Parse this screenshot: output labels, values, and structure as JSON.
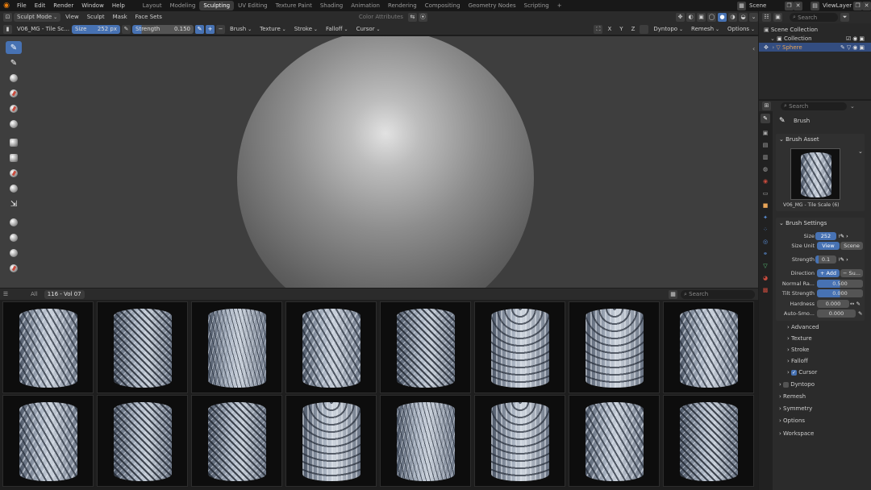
{
  "menu": [
    "File",
    "Edit",
    "Render",
    "Window",
    "Help"
  ],
  "workspaces": [
    "Layout",
    "Modeling",
    "Sculpting",
    "UV Editing",
    "Texture Paint",
    "Shading",
    "Animation",
    "Rendering",
    "Compositing",
    "Geometry Nodes",
    "Scripting"
  ],
  "active_workspace": "Sculpting",
  "scene": "Scene",
  "view_layer": "ViewLayer",
  "header1": {
    "mode": "Sculpt Mode",
    "menus": [
      "View",
      "Sculpt",
      "Mask",
      "Face Sets"
    ],
    "color_attributes": "Color Attributes"
  },
  "header2": {
    "brush_name": "V06_MG - Tile Sc...",
    "size_label": "Size",
    "size_value": "252 px",
    "strength_label": "Strength",
    "strength_value": "0.150",
    "menus": [
      "Brush",
      "Texture",
      "Stroke",
      "Falloff",
      "Cursor"
    ],
    "axes": [
      "X",
      "Y",
      "Z"
    ],
    "dyntopo": "Dyntopo",
    "remesh": "Remesh",
    "options": "Options"
  },
  "outliner": {
    "search_placeholder": "Search",
    "scene_collection": "Scene Collection",
    "collection": "Collection",
    "object": "Sphere"
  },
  "asset_browser": {
    "catalog_all": "All",
    "catalog_current": "116 - Vol 07",
    "search_placeholder": "Search",
    "thumbnails": 16
  },
  "properties": {
    "search_placeholder": "Search",
    "brush_title": "Brush",
    "brush_asset_panel": "Brush Asset",
    "asset_name": "V06_MG - Tile Scale (6)",
    "brush_settings_panel": "Brush Settings",
    "size_label": "Size",
    "size_value": "252",
    "size_unit_label": "Size Unit",
    "size_unit_view": "View",
    "size_unit_scene": "Scene",
    "strength_label": "Strength",
    "strength_value": "0.1",
    "direction_label": "Direction",
    "direction_add": "+ Add",
    "direction_sub": "− Su...",
    "normal_radius_label": "Normal Ra...",
    "normal_radius_value": "0.500",
    "tilt_strength_label": "Tilt Strength",
    "tilt_strength_value": "0.000",
    "hardness_label": "Hardness",
    "hardness_value": "0.000",
    "auto_smooth_label": "Auto-Smo...",
    "auto_smooth_value": "0.000",
    "subpanels": [
      "Advanced",
      "Texture",
      "Stroke",
      "Falloff",
      "Cursor"
    ],
    "panels": [
      "Dyntopo",
      "Remesh",
      "Symmetry",
      "Options",
      "Workspace"
    ]
  }
}
